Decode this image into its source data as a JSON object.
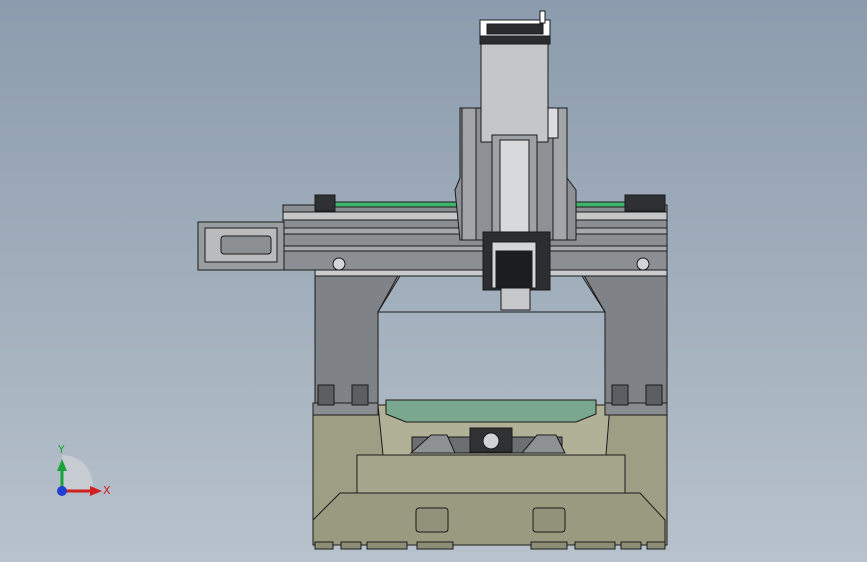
{
  "colors": {
    "background_top": "#8c9cae",
    "background_bottom": "#b8c2cc",
    "base_casting": "#9e9e84",
    "gantry_steel": "#7f8286",
    "rail_guide": "#3fb36b",
    "worktable": "#79a88f",
    "outline": "#1a1a1a",
    "axis_x": "#d11f1f",
    "axis_y": "#19a33a",
    "axis_z": "#1f3fd1"
  },
  "icons": {
    "triad": "coordinate-triad-icon"
  },
  "triad": {
    "x_label": "X",
    "y_label": "Y"
  }
}
